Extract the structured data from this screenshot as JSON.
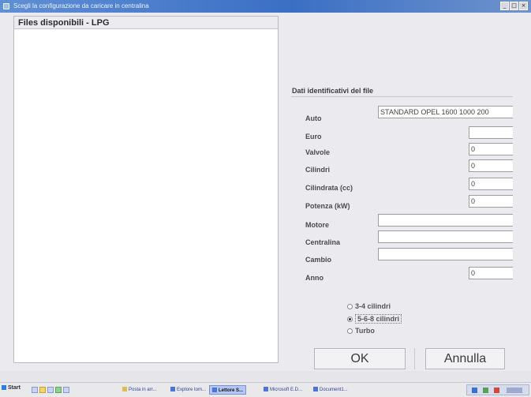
{
  "window": {
    "title": "Scegli la configurazione da caricare in centralina",
    "controls": [
      "_",
      "□",
      "×"
    ]
  },
  "files_panel": {
    "header": "Files disponibili - LPG"
  },
  "file_info": {
    "group_title": "Dati identificativi del file",
    "fields": [
      {
        "label": "Auto",
        "value": "STANDARD OPEL 1600 1000 200"
      },
      {
        "label": "Euro",
        "value": ""
      },
      {
        "label": "Valvole",
        "value": "0"
      },
      {
        "label": "Cilindri",
        "value": "0"
      },
      {
        "label": "Cilindrata (cc)",
        "value": "0"
      },
      {
        "label": "Potenza (kW)",
        "value": "0"
      },
      {
        "label": "Motore",
        "value": ""
      },
      {
        "label": "Centralina",
        "value": ""
      },
      {
        "label": "Cambio",
        "value": ""
      },
      {
        "label": "Anno",
        "value": "0"
      }
    ]
  },
  "cylinder_options": {
    "options": [
      "3-4 cilindri",
      "5-6-8 cilindri",
      "Turbo"
    ],
    "selected": "5-6-8 cilindri"
  },
  "buttons": {
    "ok": "OK",
    "cancel": "Annulla"
  },
  "taskbar": {
    "start_label": "Start",
    "tasks": [
      "Posta in arr...",
      "Explore tom...",
      "Lettore S...",
      "Microsoft E.D...",
      "Document1..."
    ],
    "active_task": "Lettore S...",
    "tray_icons": [
      "network-icon",
      "volume-icon",
      "antivirus-icon",
      "clock-icon"
    ]
  },
  "colors": {
    "titlebar": "#3b6fc4",
    "background": "#ebebef",
    "field_border": "#9c9ca3"
  }
}
